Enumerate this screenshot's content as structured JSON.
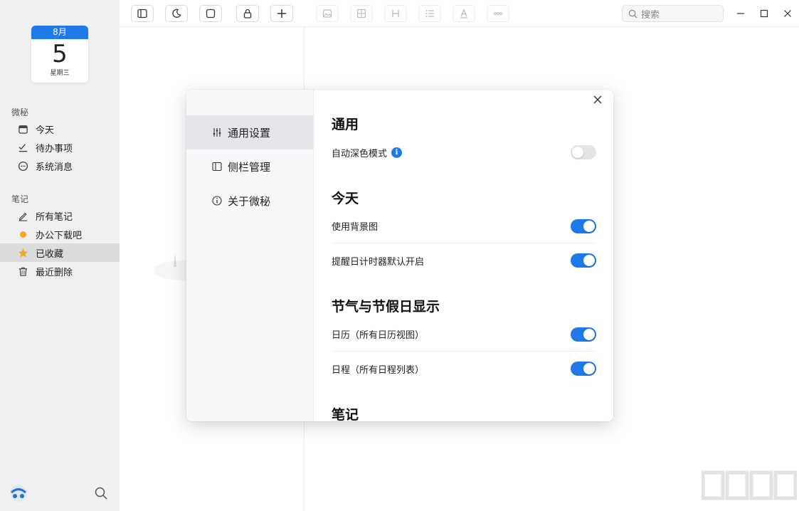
{
  "calendar": {
    "month": "8月",
    "day": "5",
    "weekday": "星期三"
  },
  "sidebar": {
    "sections": [
      {
        "title": "微秘",
        "items": [
          {
            "label": "今天",
            "icon": "calendar-icon"
          },
          {
            "label": "待办事项",
            "icon": "checklist-icon"
          },
          {
            "label": "系统消息",
            "icon": "message-icon"
          }
        ]
      },
      {
        "title": "笔记",
        "items": [
          {
            "label": "所有笔记",
            "icon": "pen-icon"
          },
          {
            "label": "办公下载吧",
            "icon": "folder-dot-icon",
            "color": "#f5a623"
          },
          {
            "label": "已收藏",
            "icon": "star-icon",
            "color": "#f5a623",
            "active": true
          },
          {
            "label": "最近删除",
            "icon": "trash-icon"
          }
        ]
      }
    ]
  },
  "toolbar": {
    "buttons": [
      "sidebar-toggle-icon",
      "moon-icon",
      "square-icon",
      "lock-icon",
      "plus-icon",
      "image-icon",
      "table-icon",
      "heading-icon",
      "list-icon",
      "text-color-icon",
      "more-icon"
    ],
    "search_placeholder": "搜索"
  },
  "settings": {
    "nav": [
      {
        "label": "通用设置",
        "icon": "sliders-icon",
        "active": true
      },
      {
        "label": "侧栏管理",
        "icon": "sidebar-icon"
      },
      {
        "label": "关于微秘",
        "icon": "info-icon"
      }
    ],
    "sections": [
      {
        "title": "通用",
        "rows": [
          {
            "label": "自动深色模式",
            "info": true,
            "on": false
          }
        ]
      },
      {
        "title": "今天",
        "rows": [
          {
            "label": "使用背景图",
            "on": true
          },
          {
            "label": "提醒日计时器默认开启",
            "on": true
          }
        ]
      },
      {
        "title": "节气与节假日显示",
        "rows": [
          {
            "label": "日历（所有日历视图）",
            "on": true
          },
          {
            "label": "日程（所有日程列表）",
            "on": true
          }
        ]
      },
      {
        "title": "笔记",
        "rows": []
      }
    ]
  },
  "colors": {
    "accent": "#1f7ae8",
    "favorite": "#f5a623"
  }
}
